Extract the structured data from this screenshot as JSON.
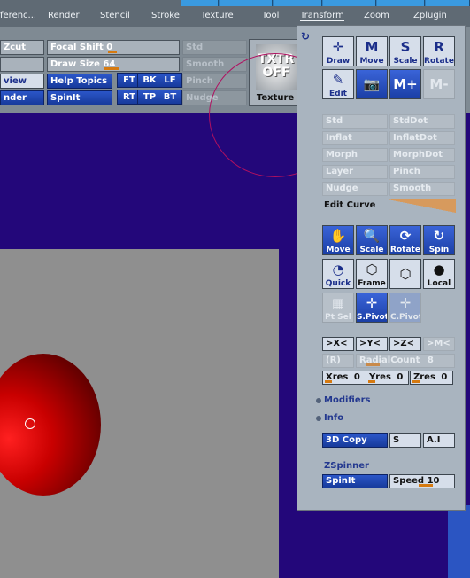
{
  "menu": [
    "ferenc...",
    "Render",
    "Stencil",
    "Stroke",
    "Texture",
    "Tool",
    "Transform",
    "Zoom",
    "Zplugin"
  ],
  "toolbar": {
    "zcut": "Zcut",
    "focal_shift": {
      "label": "Focal Shift",
      "value": "0"
    },
    "std": "Std",
    "draw_size": {
      "label": "Draw Size",
      "value": "64"
    },
    "smooth": "Smooth",
    "view": "view",
    "help_topics": "Help Topics",
    "ft": "FT",
    "bk": "BK",
    "lf": "LF",
    "pinch": "Pinch",
    "nder": "nder",
    "spinit": "SpinIt",
    "rt": "RT",
    "tp": "TP",
    "bt": "BT",
    "nudge": "Nudge",
    "texture_thumb": "TXTR\nOFF",
    "texture_label": "Texture"
  },
  "transform": {
    "draw_modes": [
      {
        "label": "Draw",
        "icon": "draw-icon",
        "glyph": "✛"
      },
      {
        "label": "Move",
        "icon": "move-M-icon",
        "glyph": "M"
      },
      {
        "label": "Scale",
        "icon": "scale-S-icon",
        "glyph": "S"
      },
      {
        "label": "Rotate",
        "icon": "rotate-R-icon",
        "glyph": "R"
      }
    ],
    "edit": "Edit",
    "edit_row_glyphs": [
      "✎",
      "📷",
      "M+",
      "M-"
    ],
    "deform": [
      [
        "Std",
        "StdDot"
      ],
      [
        "Inflat",
        "InflatDot"
      ],
      [
        "Morph",
        "MorphDot"
      ],
      [
        "Layer",
        "Pinch"
      ],
      [
        "Nudge",
        "Smooth"
      ]
    ],
    "edit_curve": "Edit Curve",
    "nav": [
      {
        "label": "Move",
        "glyph": "✋"
      },
      {
        "label": "Scale",
        "glyph": "🔍"
      },
      {
        "label": "Rotate",
        "glyph": "⟳"
      },
      {
        "label": "Spin",
        "glyph": "↻"
      }
    ],
    "render_modes": [
      {
        "label": "Quick",
        "glyph": "◔"
      },
      {
        "label": "Frame",
        "glyph": "⬡"
      },
      {
        "label": "",
        "glyph": "⬡"
      },
      {
        "label": "Local",
        "glyph": "●"
      }
    ],
    "pivot": [
      "Pt Sel",
      "S.Pivot",
      "C.Pivot"
    ],
    "sym": [
      ">X<",
      ">Y<",
      ">Z<",
      ">M<"
    ],
    "r": "(R)",
    "radial_count": {
      "label": "RadialCount",
      "value": "8"
    },
    "res": [
      {
        "label": "Xres",
        "value": "0"
      },
      {
        "label": "Yres",
        "value": "0"
      },
      {
        "label": "Zres",
        "value": "0"
      }
    ],
    "modifiers": "Modifiers",
    "info": "Info",
    "copy_3d": "3D Copy",
    "s": "S",
    "ai": "A.I",
    "zspinner": "ZSpinner",
    "spinit": "SpinIt",
    "speed": {
      "label": "Speed",
      "value": "10"
    }
  }
}
